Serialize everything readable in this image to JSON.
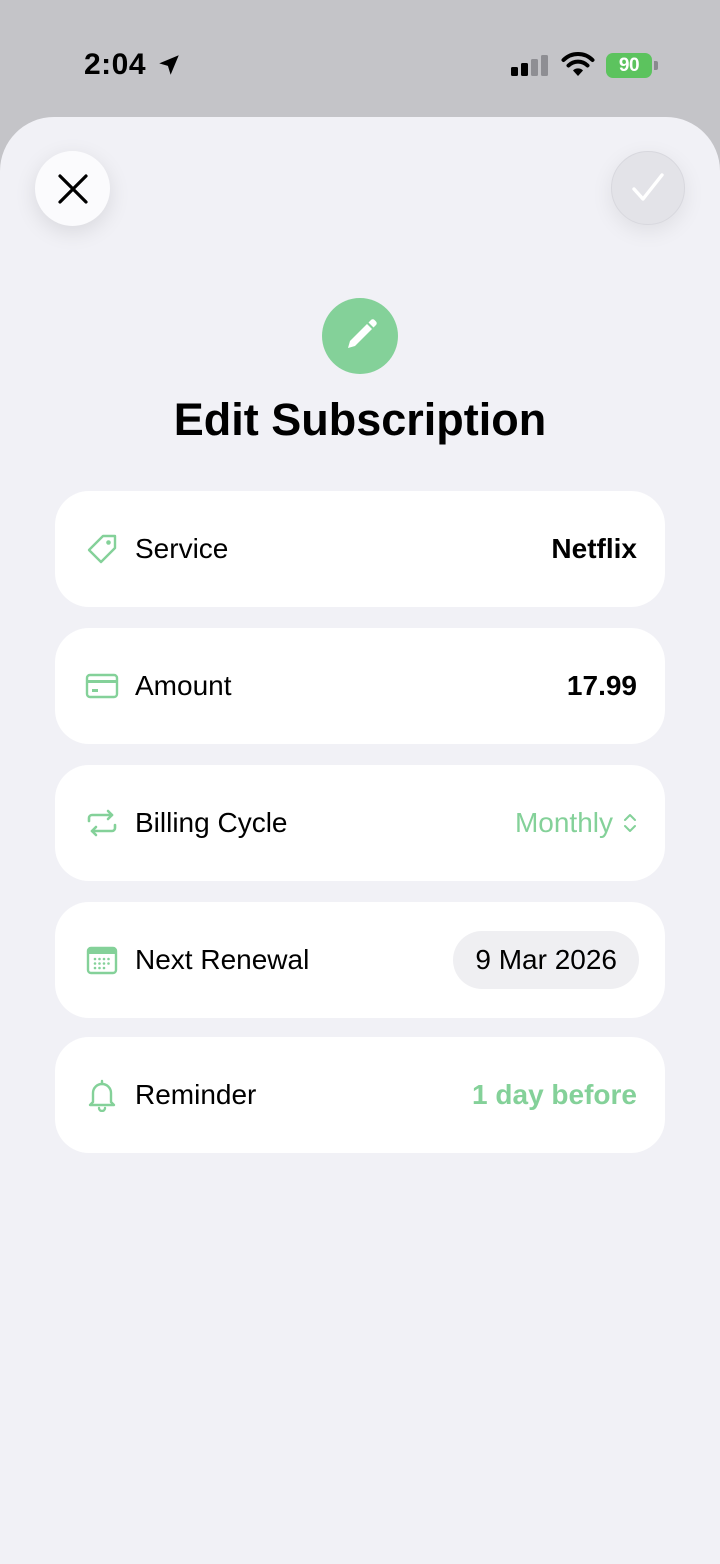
{
  "status_bar": {
    "time": "2:04",
    "battery": "90"
  },
  "header": {
    "title": "Edit Subscription"
  },
  "form": {
    "rows": [
      {
        "label": "Service",
        "value": "Netflix"
      },
      {
        "label": "Amount",
        "value": "17.99"
      },
      {
        "label": "Billing Cycle",
        "value": "Monthly"
      },
      {
        "label": "Next Renewal",
        "value": "9 Mar 2026"
      },
      {
        "label": "Reminder",
        "value": "1 day before"
      }
    ]
  },
  "colors": {
    "accent": "#84d199",
    "sheet_background": "#f1f1f6",
    "status_bar_background": "#c4c4c8"
  },
  "icons": {
    "close": "close-icon",
    "done": "checkmark-icon",
    "hero": "pencil-icon",
    "service": "tag-icon",
    "amount": "credit-card-icon",
    "billing_cycle": "repeat-icon",
    "next_renewal": "calendar-icon",
    "reminder": "bell-icon"
  }
}
